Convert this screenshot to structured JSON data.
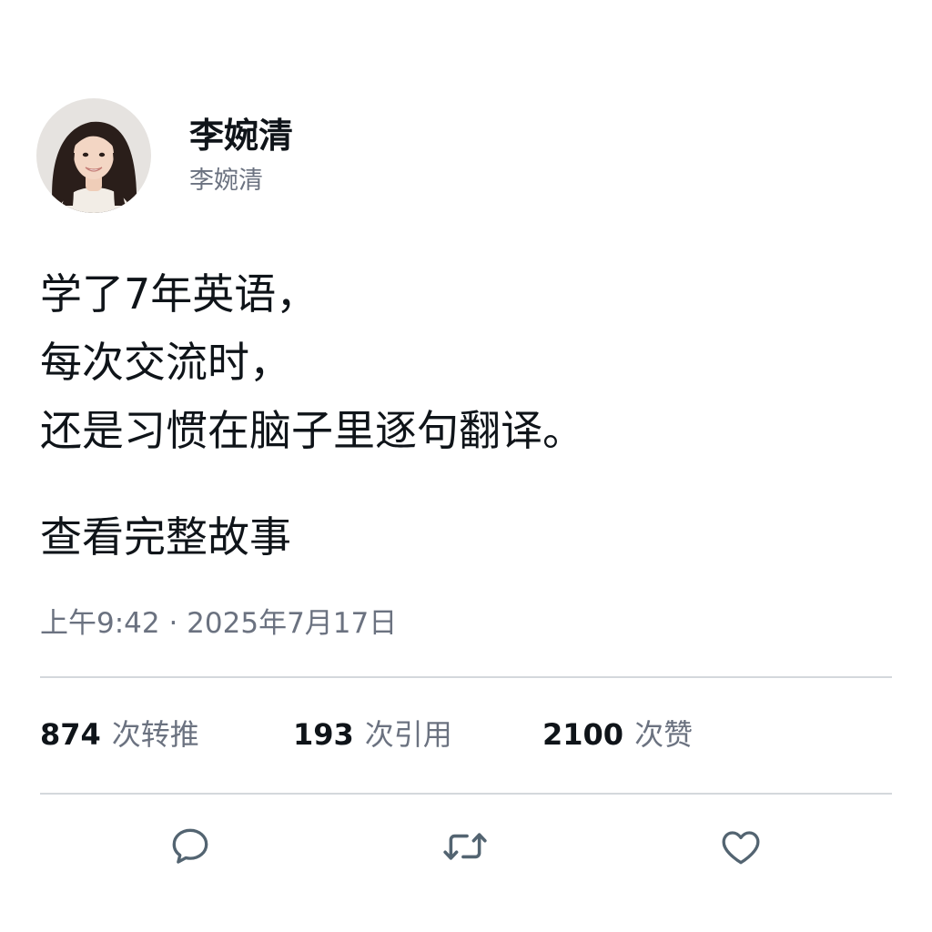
{
  "author": {
    "display_name": "李婉清",
    "handle": "李婉清"
  },
  "tweet": {
    "lines": [
      "学了7年英语，",
      "每次交流时，",
      "还是习惯在脑子里逐句翻译。"
    ],
    "read_more": "查看完整故事",
    "timestamp": "上午9:42 · 2025年7月17日"
  },
  "stats": {
    "retweets": {
      "count": "874",
      "label": "次转推"
    },
    "quotes": {
      "count": "193",
      "label": "次引用"
    },
    "likes": {
      "count": "2100",
      "label": "次赞"
    }
  },
  "actions": {
    "reply_icon": "reply-icon",
    "retweet_icon": "retweet-icon",
    "like_icon": "heart-icon"
  },
  "colors": {
    "text_primary": "#0f1419",
    "text_secondary": "#6b7280",
    "divider": "#d4d8dc",
    "icon": "#536471"
  }
}
